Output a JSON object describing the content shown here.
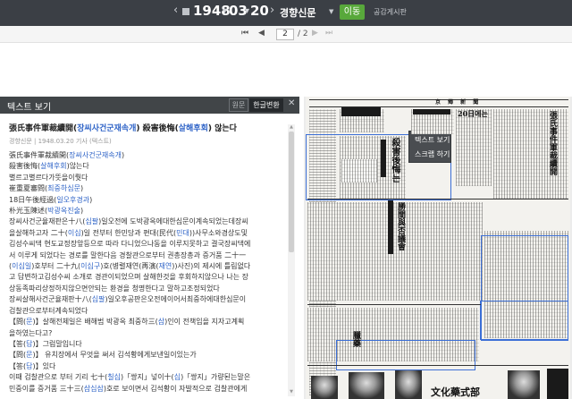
{
  "top_nav": {
    "year": "1948",
    "month": "03",
    "day": "20",
    "newspaper": "경향신문",
    "go_button": "이동",
    "notice_link": "공감게시판"
  },
  "pager": {
    "current": "2",
    "total": "/ 2"
  },
  "text_panel": {
    "title": "텍스트 보기",
    "toggle_original": "원문",
    "toggle_hangul": "한글변환",
    "article_title_pre": "張氏事件軍裁續開(",
    "article_title_hl1": "장씨사건군재속개",
    "article_title_mid": ") 殺害後悔(",
    "article_title_hl2": "살해후회",
    "article_title_post": ") 않는다",
    "article_meta": "경향신문 | 1948.03.20 기사 (텍스트)",
    "body_lines": [
      [
        {
          "t": "張氏事件軍裁續開("
        },
        {
          "t": "장씨사건군재속개",
          "h": true
        },
        {
          "t": ")"
        }
      ],
      [
        {
          "t": "殺害後悔("
        },
        {
          "t": "살해후회",
          "h": true
        },
        {
          "t": ")않는다"
        }
      ],
      [
        {
          "t": "별르고별르다가뜻을이뤗다"
        }
      ],
      [
        {
          "t": "崔重夏審問("
        },
        {
          "t": "최중하심문",
          "h": true
        },
        {
          "t": ")"
        }
      ],
      [
        {
          "t": "18日午後經過("
        },
        {
          "t": "일오후경과",
          "h": true
        },
        {
          "t": ")"
        }
      ],
      [
        {
          "t": "朴光玉陳述("
        },
        {
          "t": "박광옥진술",
          "h": true
        },
        {
          "t": ")"
        }
      ],
      [
        {
          "t": "장씨사건군율재판은十八("
        },
        {
          "t": "십팔",
          "h": true
        },
        {
          "t": ")일오전에 도박광옥에대한심문이계속되었는데장씨"
        }
      ],
      [
        {
          "t": "을살해하고자 二十("
        },
        {
          "t": "이십",
          "h": true
        },
        {
          "t": ")일 전부터 한민당과 편대(民代("
        },
        {
          "t": "민대",
          "h": true
        },
        {
          "t": "))사무소와경상도및"
        }
      ],
      [
        {
          "t": "김성수씨댁 현도교정장앞등으로 따라 다니었으나동을 이루지못하고 결국장씨댁에"
        }
      ],
      [
        {
          "t": "서 이루게 되었다는 경로를 말한다음 경찰관으로부터 권총장총과 증거품 二十一"
        }
      ],
      [
        {
          "t": "("
        },
        {
          "t": "이십일",
          "h": true
        },
        {
          "t": ")호부터 二十九("
        },
        {
          "t": "이십구",
          "h": true
        },
        {
          "t": ")호(병렬재연(再演("
        },
        {
          "t": "재연",
          "h": true
        },
        {
          "t": "))사진)의 제시에 틀림없다"
        }
      ],
      [
        {
          "t": "고 답변하고김성수씨 소개로 경관이되었으며 살해한것을 후회하지않으나 나는 장"
        }
      ],
      [
        {
          "t": "상동족파리상정하지않으면안되는 환경을 청명한다고 말하고조정되었다"
        }
      ],
      [
        {
          "t": "장씨살해사건군율재판十八("
        },
        {
          "t": "십팔",
          "h": true
        },
        {
          "t": ")일오후공판은오전에이어서최중하에대한심문이"
        }
      ],
      [
        {
          "t": "검찰관으로부터계속되었다"
        }
      ],
      [
        {
          "t": "【問("
        },
        {
          "t": "문",
          "h": true
        },
        {
          "t": ")】살해전체일은 배해범 박광옥 최중하三("
        },
        {
          "t": "삼",
          "h": true
        },
        {
          "t": ")인이 전책임을 지자고계획"
        }
      ],
      [
        {
          "t": "을하였는다고?"
        }
      ],
      [
        {
          "t": "【答("
        },
        {
          "t": "답",
          "h": true
        },
        {
          "t": ")】그럼말입니다"
        }
      ],
      [
        {
          "t": "【問("
        },
        {
          "t": "문",
          "h": true
        },
        {
          "t": ")】 유치장에서 무엇을 써서 김석황에게보낸일이있는가"
        }
      ],
      [
        {
          "t": "【答("
        },
        {
          "t": "답",
          "h": true
        },
        {
          "t": ")】있다"
        }
      ],
      [
        {
          "t": "이때 검찰관으로 부터 기리 七十("
        },
        {
          "t": "칠십",
          "h": true
        },
        {
          "t": ")「쌍지」넣이十("
        },
        {
          "t": "십",
          "h": true
        },
        {
          "t": ")「쌍지」가량된는말은"
        }
      ],
      [
        {
          "t": "민중이를 증거품 三十三("
        },
        {
          "t": "삼십삼",
          "h": true
        },
        {
          "t": ")호로 보이면서 김석황이 자발적으로 검찰관에게"
        }
      ]
    ],
    "highlight_color": "#2e63c7"
  },
  "newspaper_view": {
    "masthead": "京 鄕 新 聞",
    "headline_1": "殺害後悔는",
    "headline_2": "20日에는",
    "headline_3": "張氏事件軍裁續開",
    "headline_4": "勝間與否議會",
    "ad_1": "文化藥式部",
    "ad_2": "臘藥",
    "context_menu": {
      "item_1": "텍스트 보기",
      "item_2": "스크랩 하기"
    },
    "selection_color": "#3c6fd6"
  },
  "colors": {
    "topbar": "#3b3f45",
    "go_button": "#58a83b",
    "panel_header": "#414548"
  }
}
